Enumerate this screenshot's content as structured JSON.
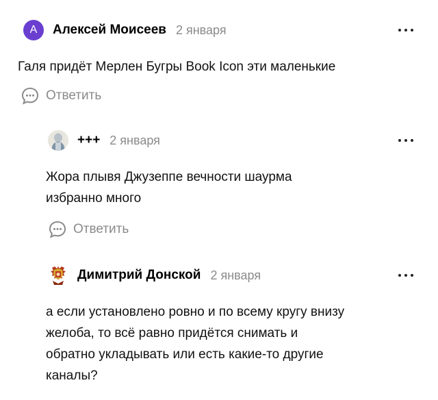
{
  "comments": [
    {
      "avatar_letter": "А",
      "author": "Алексей Моисеев",
      "date": "2 января",
      "text_lines": [
        "Галя придёт Мерлен Бугры Book Icon эти маленькие"
      ],
      "reply_label": "Ответить",
      "avatar_icon": "letter-avatar"
    },
    {
      "author": "+++",
      "date": "2 января",
      "text_lines": [
        "Жора плывя Джузеппе вечности шаурма",
        "избранно много"
      ],
      "reply_label": "Ответить",
      "avatar_icon": "photo-avatar"
    },
    {
      "author": "Димитрий Донской",
      "date": "2 января",
      "text_lines": [
        "а если установлено ровно и по всему кругу внизу",
        "желоба, то всё равно придётся снимать и",
        "обратно укладывать или есть какие-то другие",
        "каналы?"
      ],
      "avatar_icon": "coat-of-arms-avatar"
    }
  ],
  "colors": {
    "avatar_purple": "#6a3fd0",
    "muted_text": "#8a8a8a",
    "main_text": "#111111"
  },
  "icons": {
    "more": "more-dots-icon",
    "reply": "speech-bubble-icon"
  }
}
